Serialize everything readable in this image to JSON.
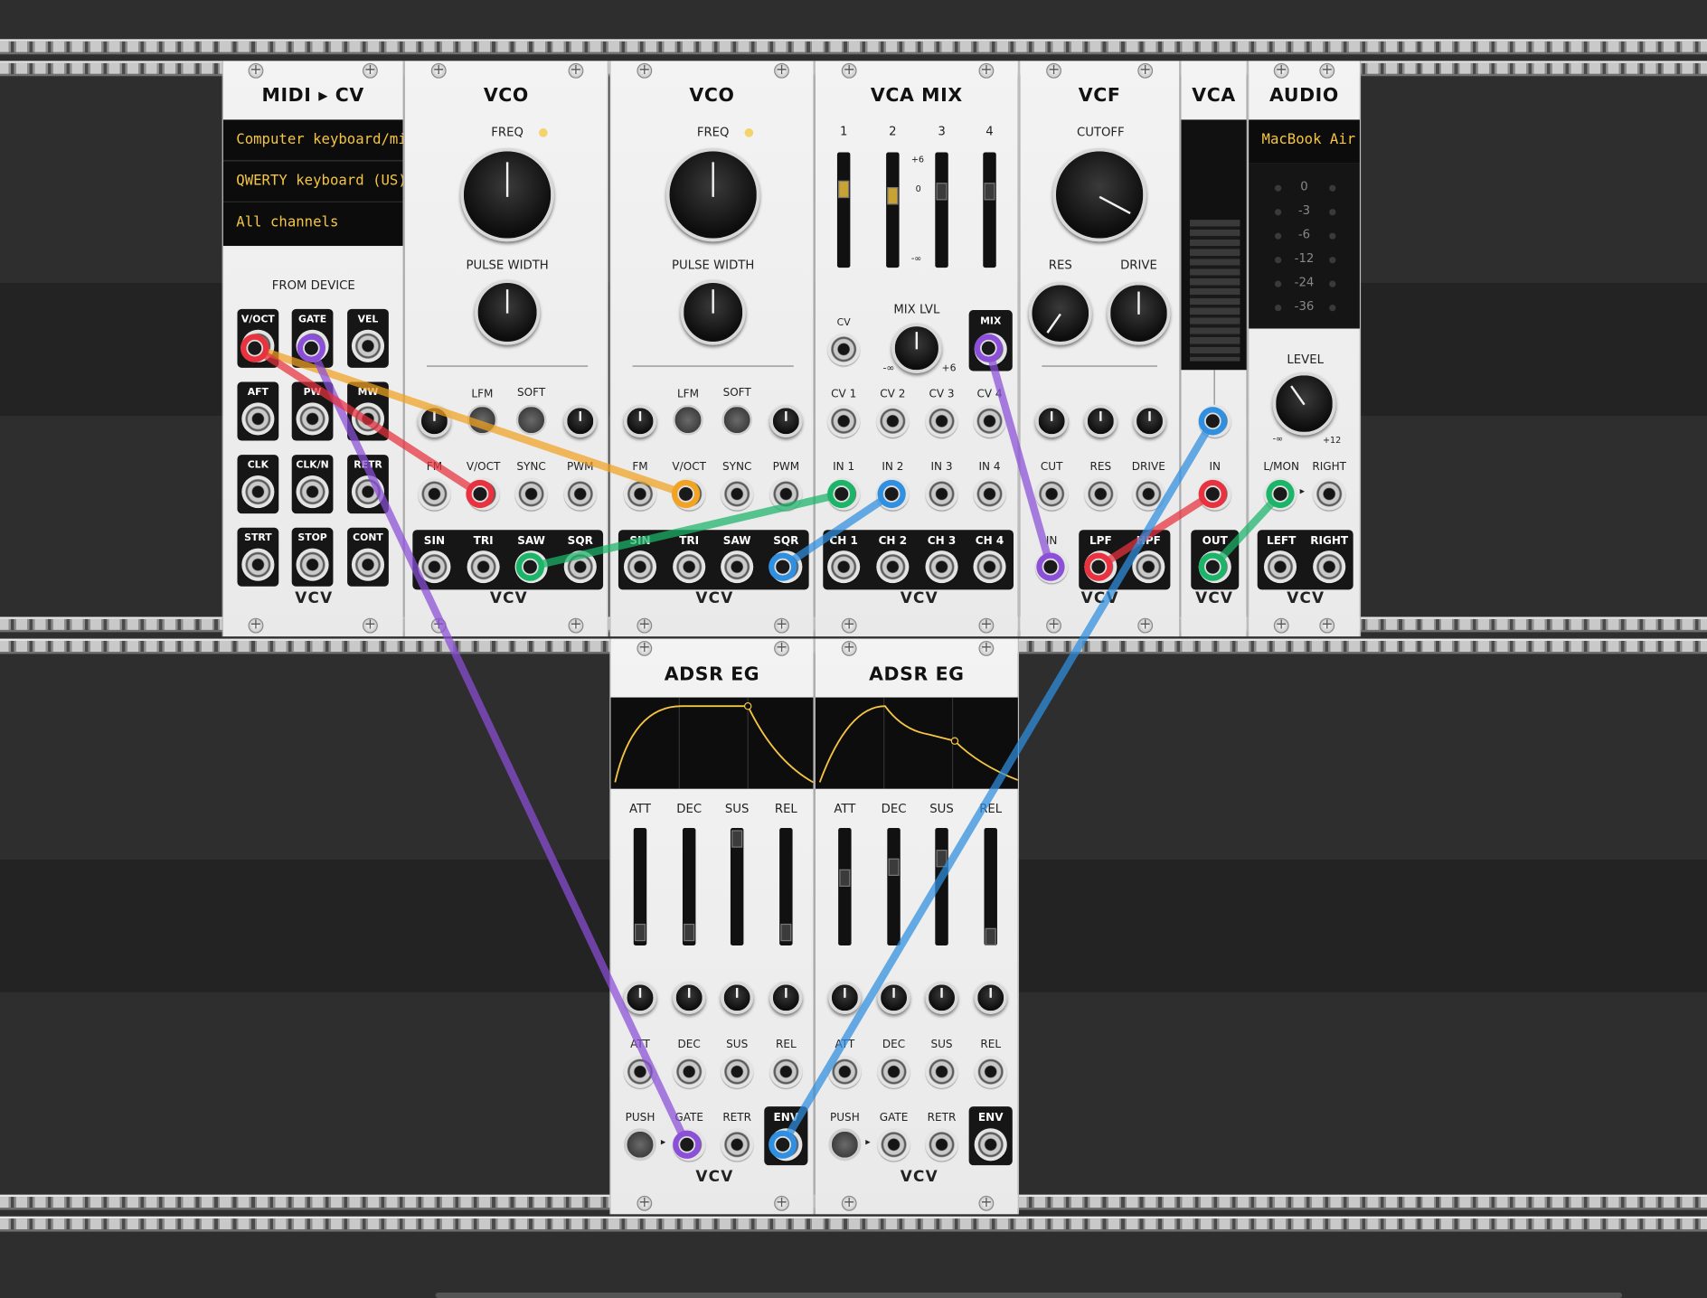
{
  "midi_cv": {
    "title": "MIDI ▸ CV",
    "driver": "Computer keyboard/midi",
    "device": "QWERTY keyboard (US)",
    "channel": "All channels",
    "from_device": "FROM DEVICE",
    "ports": [
      "V/OCT",
      "GATE",
      "VEL",
      "AFT",
      "PW",
      "MW",
      "CLK",
      "CLK/N",
      "RETR",
      "STRT",
      "STOP",
      "CONT"
    ],
    "brand": "VCV"
  },
  "vco1": {
    "title": "VCO",
    "freq": "FREQ",
    "pulse_width": "PULSE WIDTH",
    "lfm": "LFM",
    "soft": "SOFT",
    "inputs": [
      "FM",
      "V/OCT",
      "SYNC",
      "PWM"
    ],
    "outputs": [
      "SIN",
      "TRI",
      "SAW",
      "SQR"
    ],
    "brand": "VCV"
  },
  "vco2": {
    "title": "VCO",
    "freq": "FREQ",
    "pulse_width": "PULSE WIDTH",
    "lfm": "LFM",
    "soft": "SOFT",
    "inputs": [
      "FM",
      "V/OCT",
      "SYNC",
      "PWM"
    ],
    "outputs": [
      "SIN",
      "TRI",
      "SAW",
      "SQR"
    ],
    "brand": "VCV"
  },
  "vca_mix": {
    "title": "VCA MIX",
    "channels": [
      "1",
      "2",
      "3",
      "4"
    ],
    "scale": [
      "+6",
      "0",
      "-∞"
    ],
    "cv": "CV",
    "mix_lvl": "MIX LVL",
    "mix_lvl_min": "-∞",
    "mix_lvl_max": "+6",
    "mix": "MIX",
    "cv_inputs": [
      "CV 1",
      "CV 2",
      "CV 3",
      "CV 4"
    ],
    "inputs": [
      "IN 1",
      "IN 2",
      "IN 3",
      "IN 4"
    ],
    "outputs": [
      "CH 1",
      "CH 2",
      "CH 3",
      "CH 4"
    ],
    "brand": "VCV"
  },
  "vcf": {
    "title": "VCF",
    "cutoff": "CUTOFF",
    "res": "RES",
    "drive": "DRIVE",
    "cv_inputs": [
      "CUT",
      "RES",
      "DRIVE"
    ],
    "in": "IN",
    "lpf": "LPF",
    "hpf": "HPF",
    "brand": "VCV"
  },
  "vca": {
    "title": "VCA",
    "in": "IN",
    "out": "OUT",
    "brand": "VCV"
  },
  "audio": {
    "title": "AUDIO",
    "device": "MacBook Air",
    "meter": [
      "0",
      "-3",
      "-6",
      "-12",
      "-24",
      "-36"
    ],
    "level": "LEVEL",
    "level_min": "-∞",
    "level_max": "+12",
    "inputs_top": [
      "L/MON",
      "RIGHT"
    ],
    "inputs_bottom": [
      "LEFT",
      "RIGHT"
    ],
    "brand": "VCV"
  },
  "adsr1": {
    "title": "ADSR EG",
    "sliders": [
      "ATT",
      "DEC",
      "SUS",
      "REL"
    ],
    "cv_inputs": [
      "ATT",
      "DEC",
      "SUS",
      "REL"
    ],
    "push": "PUSH",
    "gate": "GATE",
    "retr": "RETR",
    "env": "ENV",
    "brand": "VCV"
  },
  "adsr2": {
    "title": "ADSR EG",
    "sliders": [
      "ATT",
      "DEC",
      "SUS",
      "REL"
    ],
    "cv_inputs": [
      "ATT",
      "DEC",
      "SUS",
      "REL"
    ],
    "push": "PUSH",
    "gate": "GATE",
    "retr": "RETR",
    "env": "ENV",
    "brand": "VCV"
  },
  "cable_colors": {
    "orange": "#f2a322",
    "purple": "#8b4fd8",
    "red": "#e8323f",
    "green": "#1cb469",
    "blue": "#2f8fe0"
  }
}
